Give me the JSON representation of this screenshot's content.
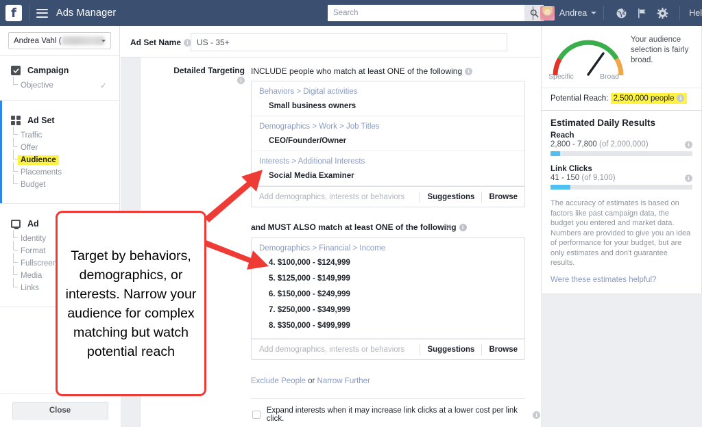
{
  "topbar": {
    "logo": "f",
    "app_title": "Ads Manager",
    "hamburger_icon": "hamburger-menu-icon",
    "search": {
      "placeholder": "Search",
      "value": "",
      "icon": "search-icon"
    },
    "user": {
      "name": "Andrea",
      "avatar": "user-avatar",
      "caret": "chevron-down-icon"
    },
    "icons": [
      {
        "name": "globe-icon",
        "label": "Globe"
      },
      {
        "name": "flag-icon",
        "label": "Flag"
      },
      {
        "name": "gear-icon",
        "label": "Settings"
      }
    ],
    "help_label": "Hel"
  },
  "sidebar": {
    "account": {
      "name": "Andrea Vahl (",
      "id_blurred": true,
      "caret": "chevron-down-icon"
    },
    "sections": [
      {
        "name": "Campaign",
        "icon": "checkbox-checked-icon",
        "active": false,
        "items": [
          {
            "label": "Objective",
            "highlight": false,
            "check": "✓"
          }
        ]
      },
      {
        "name": "Ad Set",
        "icon": "grid-icon",
        "active": true,
        "items": [
          {
            "label": "Traffic",
            "highlight": false
          },
          {
            "label": "Offer",
            "highlight": false
          },
          {
            "label": "Audience",
            "highlight": true
          },
          {
            "label": "Placements",
            "highlight": false
          },
          {
            "label": "Budget",
            "highlight": false
          }
        ]
      },
      {
        "name": "Ad",
        "icon": "monitor-icon",
        "active": false,
        "items": [
          {
            "label": "Identity",
            "highlight": false
          },
          {
            "label": "Format",
            "highlight": false
          },
          {
            "label": "Fullscreen",
            "highlight": false
          },
          {
            "label": "Media",
            "highlight": false
          },
          {
            "label": "Links",
            "highlight": false
          }
        ]
      }
    ],
    "close_label": "Close"
  },
  "adset": {
    "name_label": "Ad Set Name",
    "name_value": "US - 35+",
    "name_placeholder": "Ad Set Name",
    "info_icon": "info-icon"
  },
  "targeting": {
    "section_label": "Detailed Targeting",
    "include_title": "INCLUDE people who match at least ONE of the following",
    "include_groups": [
      {
        "path": "Behaviors > Digital activities",
        "value": "Small business owners"
      },
      {
        "path": "Demographics > Work > Job Titles",
        "value": "CEO/Founder/Owner"
      },
      {
        "path": "Interests > Additional Interests",
        "value": "Social Media Examiner"
      }
    ],
    "input_placeholder": "Add demographics, interests or behaviors",
    "suggestions_label": "Suggestions",
    "browse_label": "Browse",
    "must_also_title": "and MUST ALSO match at least ONE of the following",
    "must_also_close": "×",
    "narrow_group": {
      "path": "Demographics > Financial > Income",
      "values": [
        "4. $100,000 - $124,999",
        "5. $125,000 - $149,999",
        "6. $150,000 - $249,999",
        "7. $250,000 - $349,999",
        "8. $350,000 - $499,999"
      ]
    },
    "exclude_label": "Exclude People",
    "or_label": " or ",
    "narrow_label": "Narrow Further",
    "expand_checkbox": {
      "label": "Expand interests when it may increase link clicks at a lower cost per link click.",
      "checked": false
    }
  },
  "right_panel": {
    "gauge": {
      "specific_label": "Specific",
      "broad_label": "Broad",
      "message": "Your audience selection is fairly broad.",
      "needle_position": 0.62,
      "colors": {
        "low": "#e03426",
        "mid": "#3aae4a",
        "high": "#f0a74b"
      }
    },
    "potential_reach_label": "Potential Reach:",
    "potential_reach_value": "2,500,000 people",
    "estimated_title": "Estimated Daily Results",
    "metrics": [
      {
        "name": "Reach",
        "value": "2,800 - 7,800",
        "of": "(of 2,000,000)",
        "bar_pct": 7
      },
      {
        "name": "Link Clicks",
        "value": "41 - 150",
        "of": "(of 9,100)",
        "bar_pct": 14
      }
    ],
    "disclaimer": "The accuracy of estimates is based on factors like past campaign data, the budget you entered and market data. Numbers are provided to give you an idea of performance for your budget, but are only estimates and don't guarantee results.",
    "helpful_link": "Were these estimates helpful?"
  },
  "callout": {
    "text": "Target by behaviors, demographics, or interests.  Narrow your audience for complex matching but watch potential reach",
    "border_color": "#ef3b36",
    "arrow_color": "#ef3b36"
  }
}
